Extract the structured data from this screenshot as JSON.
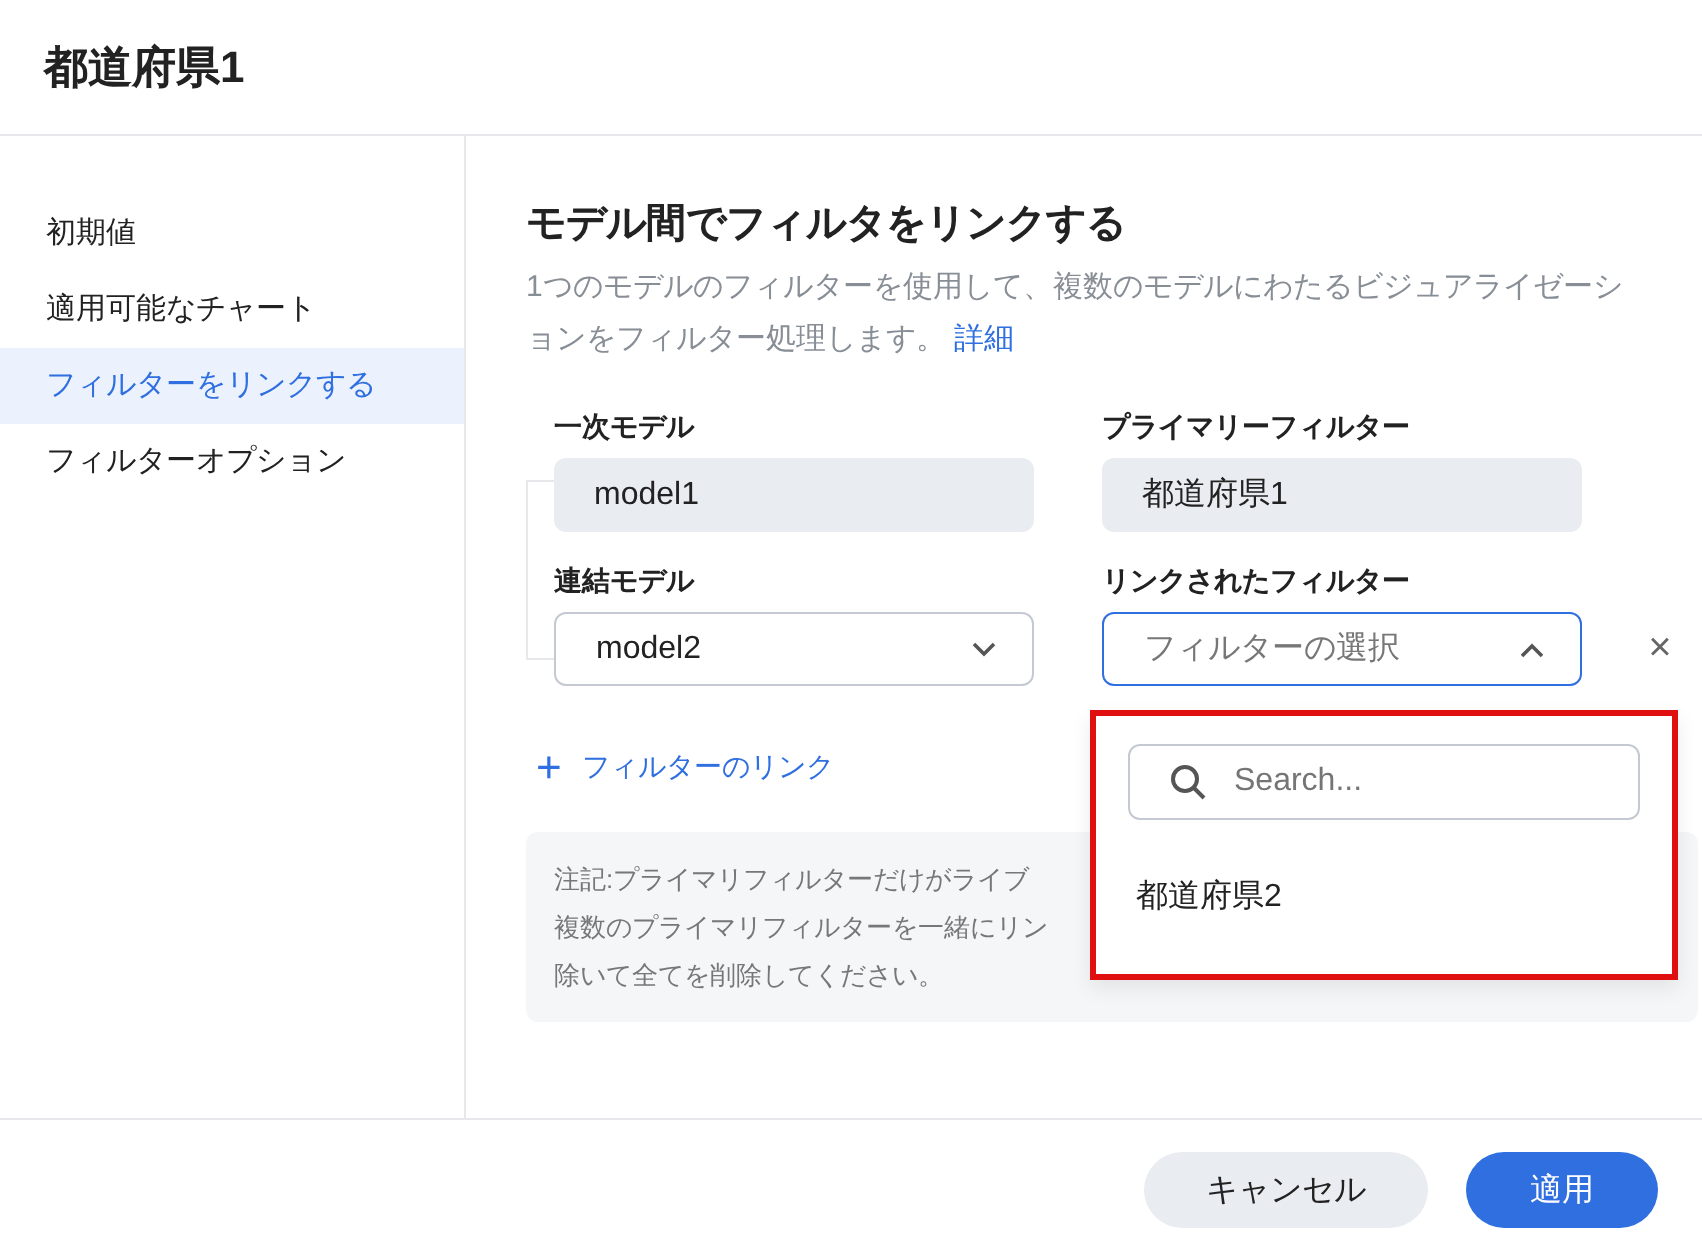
{
  "dialog": {
    "title": "都道府県1"
  },
  "sidebar": {
    "items": [
      {
        "label": "初期値",
        "selected": false
      },
      {
        "label": "適用可能なチャート",
        "selected": false
      },
      {
        "label": "フィルターをリンクする",
        "selected": true
      },
      {
        "label": "フィルターオプション",
        "selected": false
      }
    ]
  },
  "section": {
    "title": "モデル間でフィルタをリンクする",
    "description": "1つのモデルのフィルターを使用して、複数のモデルにわたるビジュアライゼーションをフィルター処理します。",
    "link": "詳細"
  },
  "primary": {
    "model_label": "一次モデル",
    "model_value": "model1",
    "filter_label": "プライマリーフィルター",
    "filter_value": "都道府県1"
  },
  "linked": {
    "model_label": "連結モデル",
    "model_value": "model2",
    "filter_label": "リンクされたフィルター",
    "filter_placeholder": "フィルターの選択",
    "expanded": true,
    "remove": "×"
  },
  "add_link": {
    "icon": "+",
    "label": "フィルターのリンク"
  },
  "note": {
    "lines": [
      "注記:プライマリフィルターだけがライブ",
      "複数のプライマリフィルターを一緒にリン",
      "除いて全てを削除してください。"
    ]
  },
  "dropdown": {
    "search_placeholder": "Search...",
    "options": [
      "都道府県2"
    ]
  },
  "footer": {
    "cancel": "キャンセル",
    "apply": "適用"
  }
}
